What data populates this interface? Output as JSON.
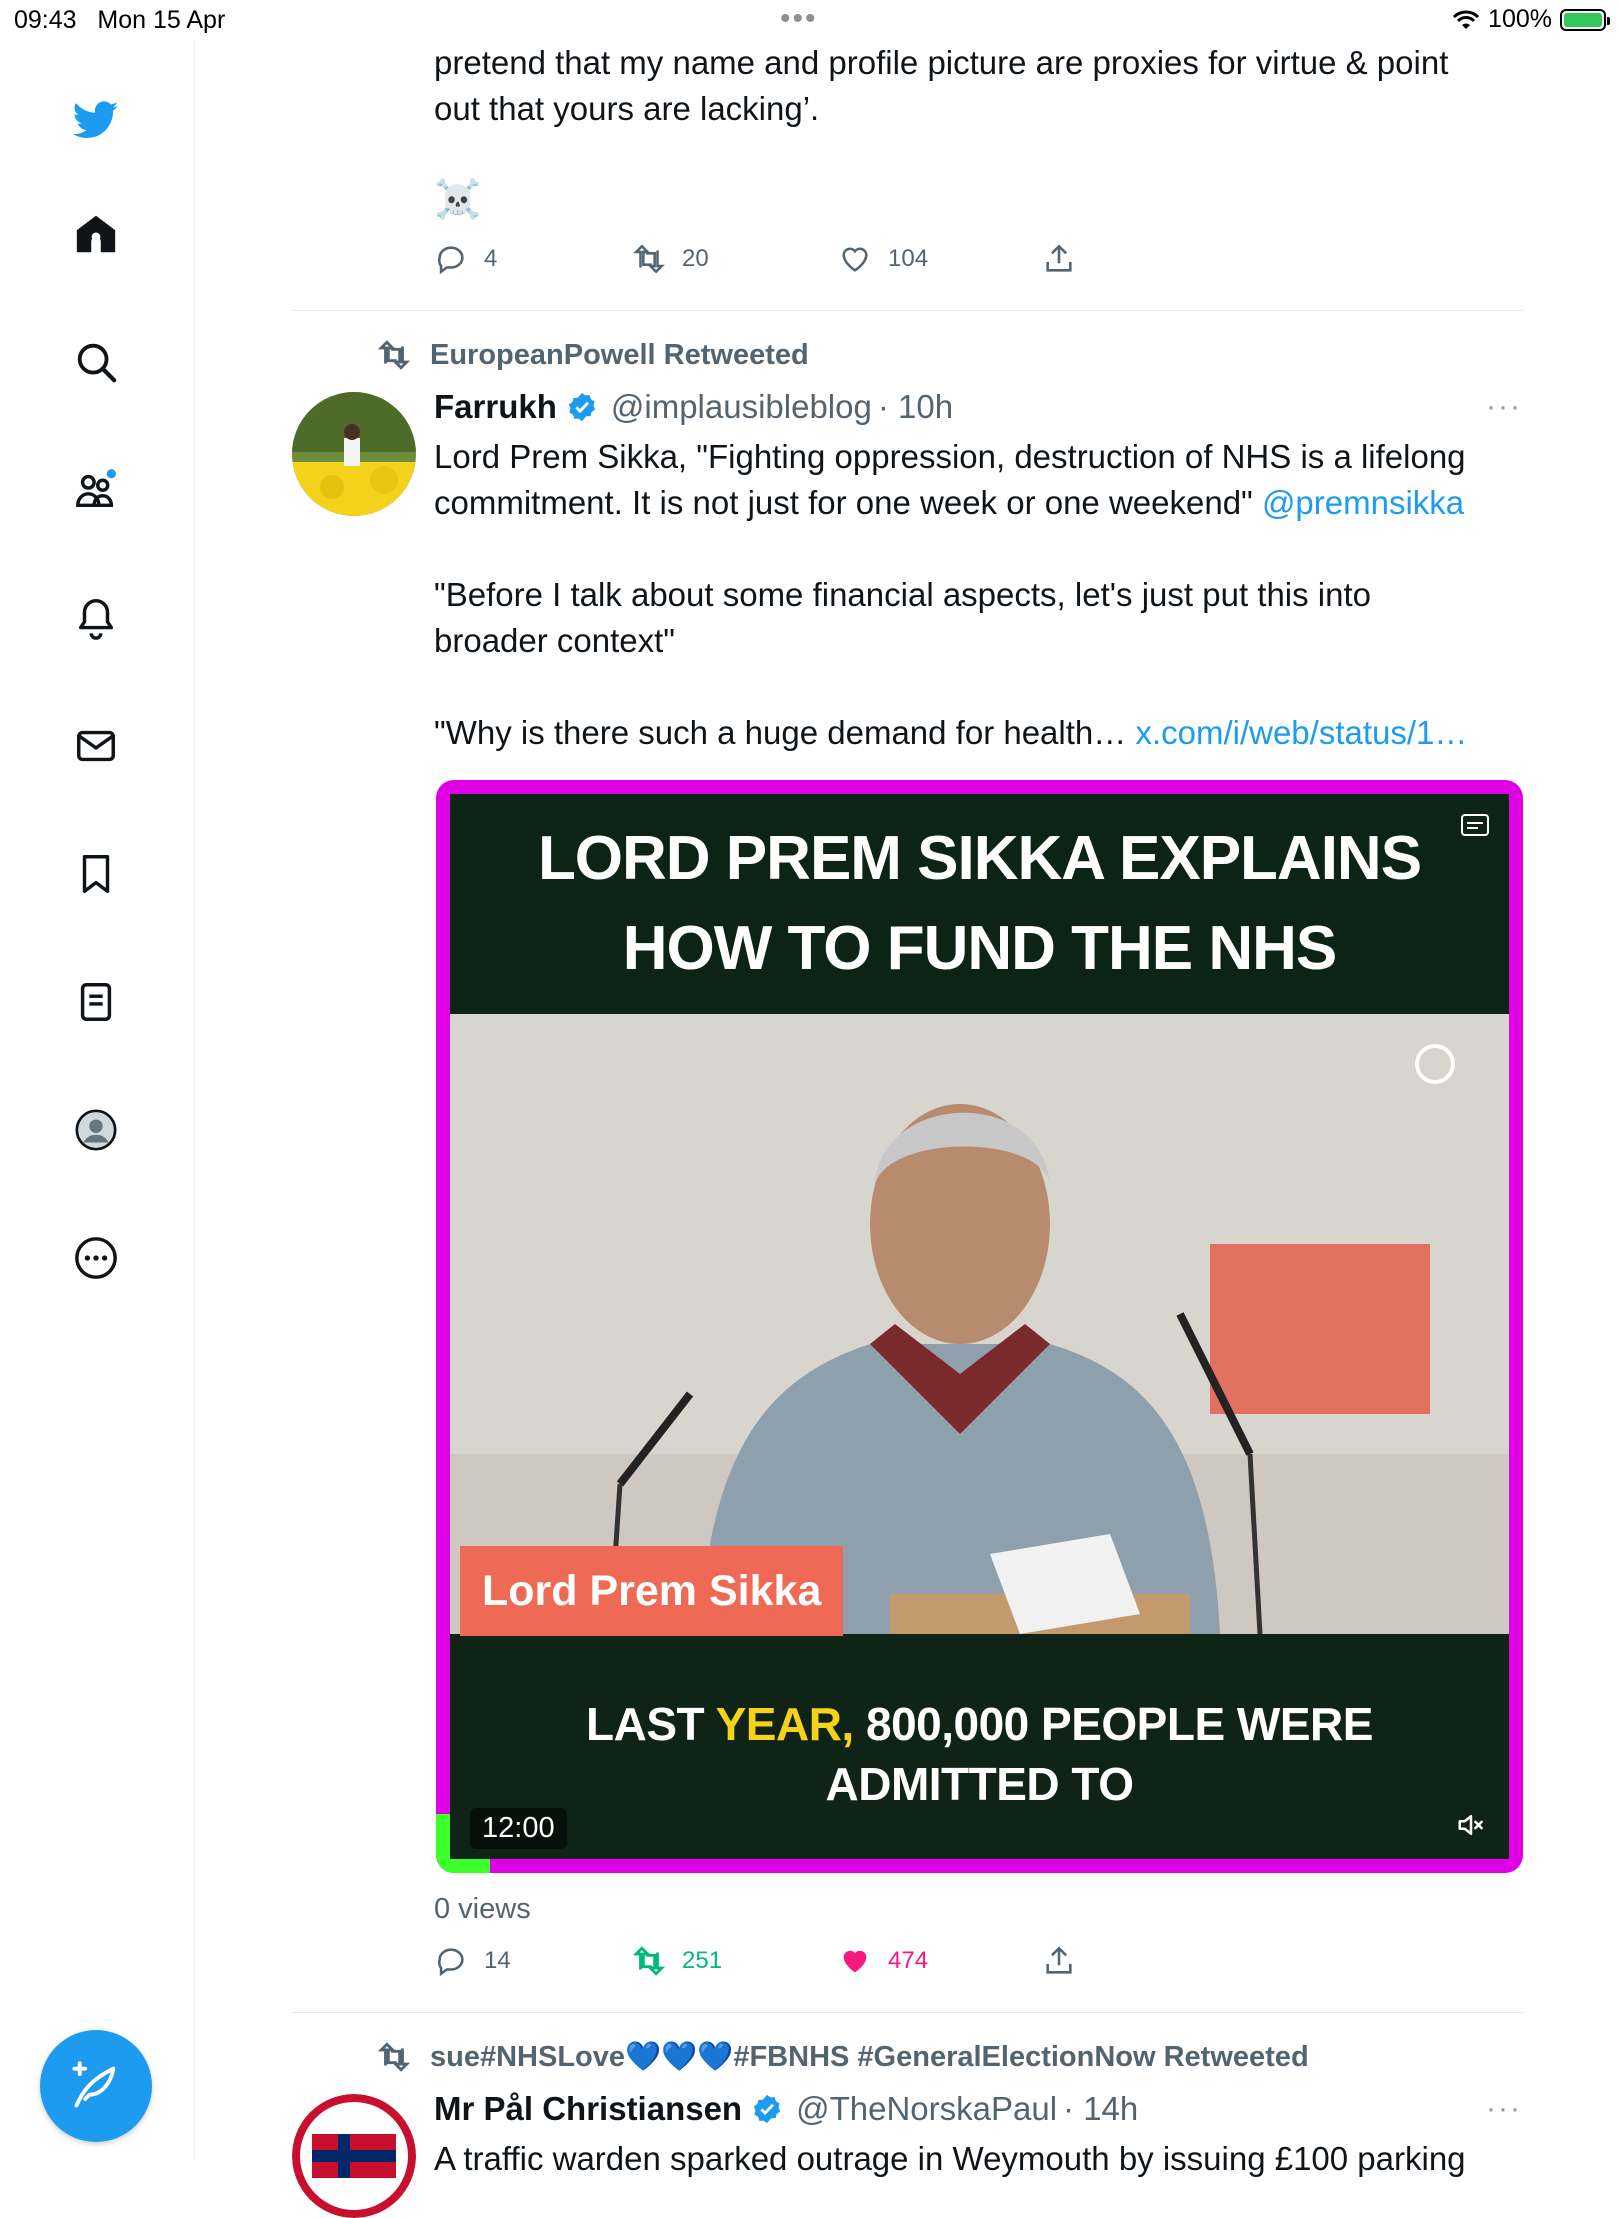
{
  "status_bar": {
    "time": "09:43",
    "date": "Mon 15 Apr",
    "center": "•••",
    "battery": "100%"
  },
  "sidebar": {
    "items": [
      "twitter-logo",
      "home",
      "search",
      "communities",
      "notifications",
      "messages",
      "bookmarks",
      "lists",
      "profile",
      "more"
    ]
  },
  "tweet1": {
    "text_line1": "pretend that my name and profile picture are proxies for virtue & point",
    "text_line2": "out that yours are lacking’.",
    "emoji": "☠️",
    "replies": "4",
    "retweets": "20",
    "likes": "104"
  },
  "tweet2": {
    "retweeted_by": "EuropeanPowell Retweeted",
    "name": "Farrukh",
    "handle": "@implausibleblog",
    "time": "· 10h",
    "more": "···",
    "text_line1": "Lord Prem Sikka, \"Fighting oppression, destruction of NHS is a lifelong",
    "text_line2": "commitment. It is not just for one week or one weekend\" ",
    "mention": "@premnsikka",
    "text_line3": "\"Before I talk about some financial aspects, let's just put this into",
    "text_line4": "broader context\"",
    "text_line5": "\"Why is there such a huge demand for health… ",
    "link": "x.com/i/web/status/1…",
    "media": {
      "headline1": "LORD PREM SIKKA EXPLAINS",
      "headline2": "HOW TO FUND THE NHS",
      "name_tag": "Lord Prem Sikka",
      "caption_a": "LAST ",
      "caption_highlight": "YEAR,",
      "caption_b": " 800,000 PEOPLE WERE",
      "caption_line2": "ADMITTED TO",
      "timer": "12:00",
      "progress_fraction": 0.05
    },
    "views": "0 views",
    "replies": "14",
    "retweets": "251",
    "likes": "474"
  },
  "tweet3": {
    "retweeted_by": "sue#NHSLove💙💙💙#FBNHS #GeneralElectionNow Retweeted",
    "name": "Mr Pål Christiansen",
    "handle": "@TheNorskaPaul",
    "time": "· 14h",
    "more": "···",
    "text_partial": "A traffic warden sparked outrage in Weymouth by issuing £100 parking"
  },
  "colors": {
    "accent": "#1d9bf0",
    "retweet_green": "#00ba7c",
    "like_pink": "#f91880",
    "muted": "#536471"
  }
}
